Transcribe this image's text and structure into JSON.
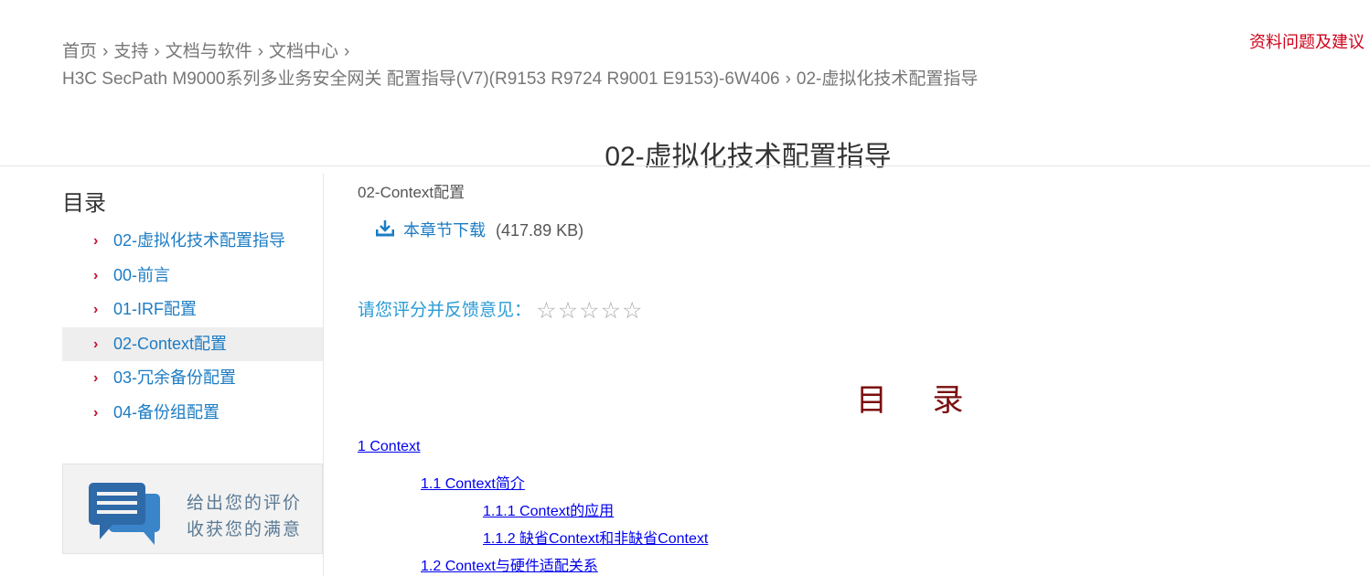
{
  "feedback_link": "资料问题及建议",
  "breadcrumb": {
    "items": [
      "首页",
      "支持",
      "文档与软件",
      "文档中心"
    ],
    "doc": "H3C SecPath M9000系列多业务安全网关 配置指导(V7)(R9153 R9724 R9001 E9153)-6W406",
    "current": "02-虚拟化技术配置指导",
    "separator": "›"
  },
  "page_title": "02-虚拟化技术配置指导",
  "sidebar": {
    "heading": "目录",
    "chevron": "›",
    "items": [
      {
        "label": "02-虚拟化技术配置指导"
      },
      {
        "label": "00-前言"
      },
      {
        "label": "01-IRF配置"
      },
      {
        "label": "02-Context配置"
      },
      {
        "label": "03-冗余备份配置"
      },
      {
        "label": "04-备份组配置"
      }
    ],
    "active_index": 3,
    "rate_card": {
      "line1": "给出您的评价",
      "line2": "收获您的满意"
    }
  },
  "main": {
    "section_name": "02-Context配置",
    "download_label": "本章节下载",
    "download_size": "(417.89 KB)",
    "rating_label": "请您评分并反馈意见：",
    "stars": [
      "☆",
      "☆",
      "☆",
      "☆",
      "☆"
    ],
    "toc_title": "目 录",
    "toc": [
      {
        "text": "1 Context",
        "level": 1
      },
      {
        "text": "1.1 Context简介",
        "level": 2
      },
      {
        "text": "1.1.1 Context的应用",
        "level": 3
      },
      {
        "text": "1.1.2 缺省Context和非缺省Context",
        "level": 3
      },
      {
        "text": "1.2 Context与硬件适配关系",
        "level": 2
      }
    ]
  },
  "colors": {
    "accent_red": "#c8102e",
    "link_blue": "#1c7cc4",
    "toc_title": "#7b0d0d"
  }
}
